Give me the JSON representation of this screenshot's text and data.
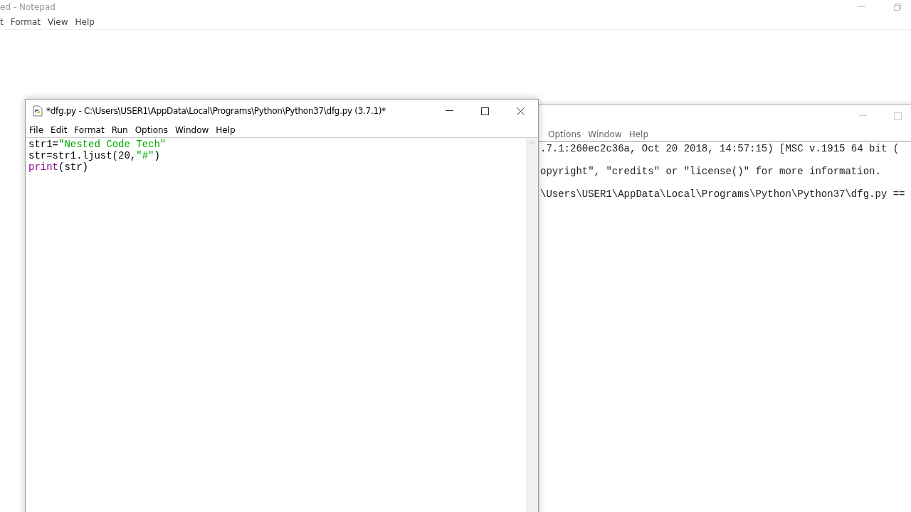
{
  "notepad": {
    "title": "ed - Notepad",
    "menu": [
      "t",
      "Format",
      "View",
      "Help"
    ]
  },
  "shell": {
    "menu": [
      "Options",
      "Window",
      "Help"
    ],
    "lines": [
      ".7.1:260ec2c36a, Oct 20 2018, 14:57:15) [MSC v.1915 64 bit (",
      "opyright\", \"credits\" or \"license()\" for more information.",
      "\\Users\\USER1\\AppData\\Local\\Programs\\Python\\Python37\\dfg.py =="
    ]
  },
  "editor": {
    "title": "*dfg.py - C:\\Users\\USER1\\AppData\\Local\\Programs\\Python\\Python37\\dfg.py (3.7.1)*",
    "menu": [
      "File",
      "Edit",
      "Format",
      "Run",
      "Options",
      "Window",
      "Help"
    ],
    "lines": [
      [
        {
          "kind": "code",
          "text": "str1="
        },
        {
          "kind": "string",
          "text": "\"Nested Code Tech\""
        }
      ],
      [
        {
          "kind": "code",
          "text": "str=str1.ljust(20,"
        },
        {
          "kind": "string",
          "text": "\"#\""
        },
        {
          "kind": "code",
          "text": ")"
        }
      ],
      [
        {
          "kind": "builtin",
          "text": "print"
        },
        {
          "kind": "code",
          "text": "(str)"
        }
      ]
    ]
  }
}
